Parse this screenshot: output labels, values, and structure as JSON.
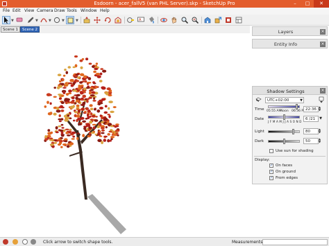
{
  "window": {
    "title": "Esdoorn - acer_fallV5 (van PHL Server).skp - SketchUp Pro",
    "minimize": "–",
    "maximize": "□",
    "close": "✕"
  },
  "menu": [
    "File",
    "Edit",
    "View",
    "Camera",
    "Draw",
    "Tools",
    "Window",
    "Help"
  ],
  "scenes": [
    "Scene 1",
    "Scene 2"
  ],
  "panels": {
    "layers": "Layers",
    "entity_info": "Entity Info",
    "shadow": {
      "title": "Shadow Settings",
      "timezone": "UTC+02:00",
      "time_label": "Time",
      "time_start": "05:55 AM",
      "time_noon": "Noon",
      "time_end": "06:36 PM",
      "time_value": "22:36",
      "date_label": "Date",
      "months": "J F M A M J J A S O N D",
      "date_value": "6 /21",
      "light_label": "Light",
      "light_value": "80",
      "light_level": 0.8,
      "dark_label": "Dark",
      "dark_value": "50",
      "dark_level": 0.5,
      "use_sun": "Use sun for shading",
      "use_sun_checked": false,
      "display_label": "Display:",
      "on_faces": "On faces",
      "on_faces_checked": true,
      "on_ground": "On ground",
      "on_ground_checked": true,
      "from_edges": "From edges",
      "from_edges_checked": true
    }
  },
  "status": {
    "hint": "Click arrow to switch shape tools.",
    "measurements_label": "Measurements"
  },
  "colors": {
    "titlebar": "#e35d2d",
    "scene_active": "#2f64b5",
    "leaves": [
      "#b5201a",
      "#c93a1e",
      "#e0661f",
      "#8a1b12",
      "#d9a441"
    ],
    "trunk": "#3a2a22",
    "shadow": "#a8a8a8"
  }
}
